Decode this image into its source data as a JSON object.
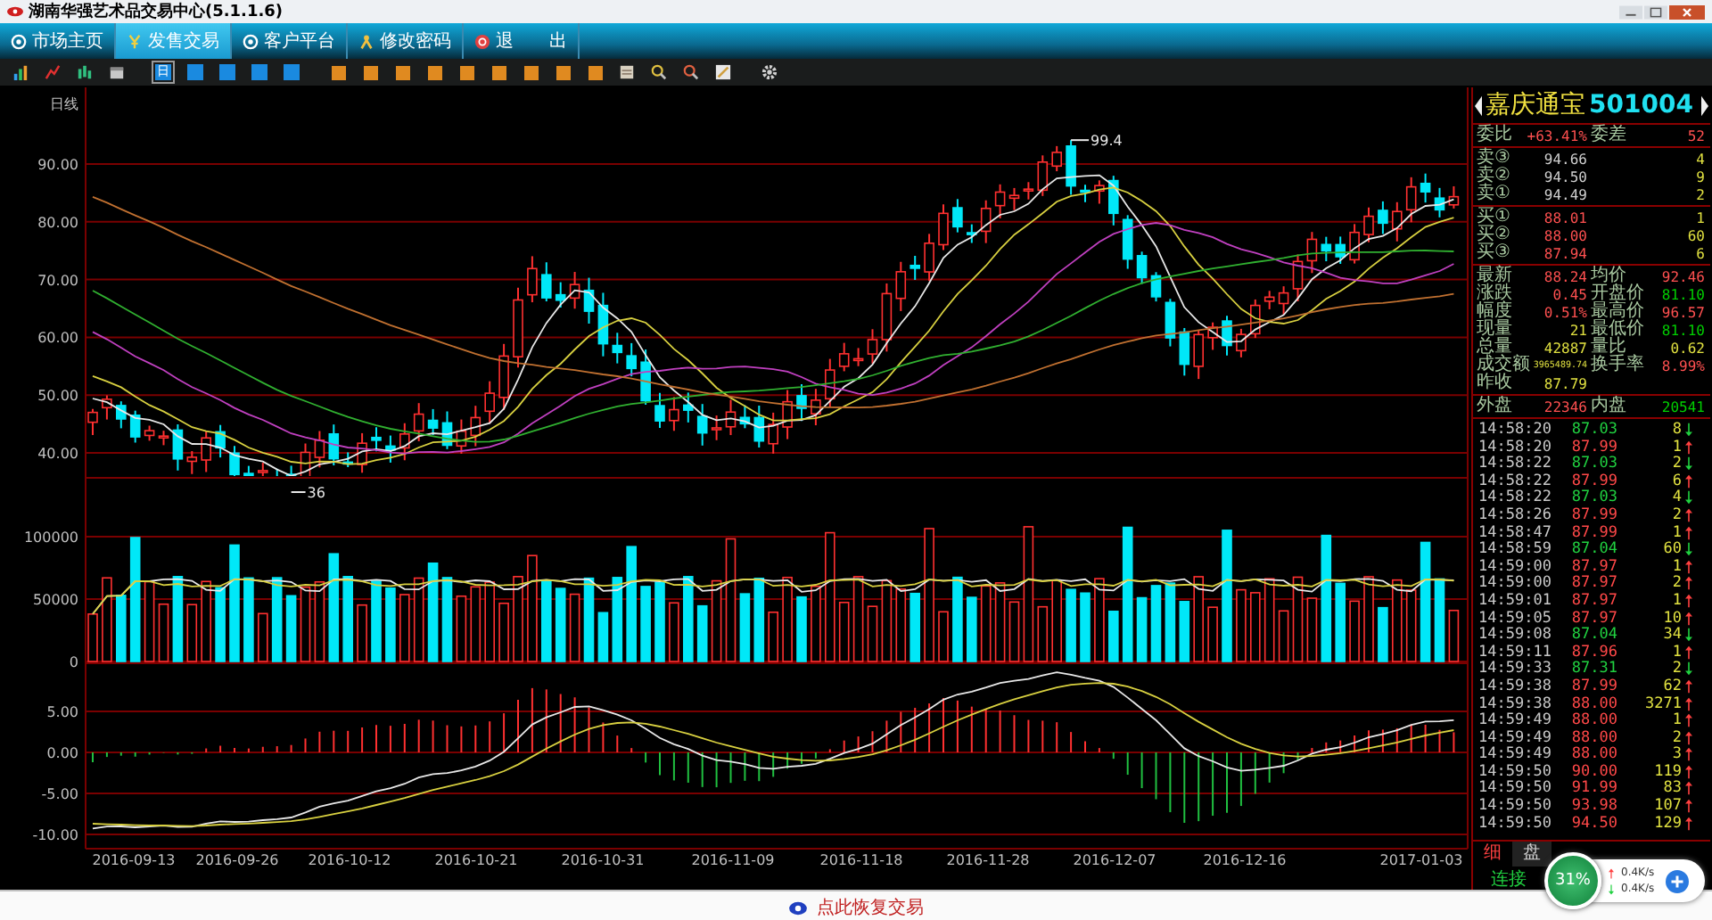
{
  "window": {
    "title": "湖南华强艺术品交易中心(5.1.1.6)"
  },
  "menu": [
    {
      "label": "市场主页",
      "selected": false
    },
    {
      "label": "发售交易",
      "selected": true
    },
    {
      "label": "客户平台",
      "selected": false
    },
    {
      "label": "修改密码",
      "selected": false
    },
    {
      "label": "退　　出",
      "selected": false
    }
  ],
  "toolbar": [
    {
      "kind": "bars",
      "selected": false
    },
    {
      "kind": "line",
      "selected": false
    },
    {
      "kind": "candles",
      "selected": false
    },
    {
      "kind": "window",
      "selected": false
    },
    {
      "kind": "blue",
      "label": "日",
      "selected": true
    },
    {
      "kind": "blue",
      "selected": false
    },
    {
      "kind": "blue",
      "selected": false
    },
    {
      "kind": "blue",
      "selected": false
    },
    {
      "kind": "blue",
      "selected": false
    },
    {
      "kind": "orange",
      "selected": false
    },
    {
      "kind": "orange",
      "selected": false
    },
    {
      "kind": "orange",
      "selected": false
    },
    {
      "kind": "orange",
      "selected": false
    },
    {
      "kind": "orange",
      "selected": false
    },
    {
      "kind": "orange",
      "selected": false
    },
    {
      "kind": "orange",
      "selected": false
    },
    {
      "kind": "orange",
      "selected": false
    },
    {
      "kind": "orange",
      "selected": false
    },
    {
      "kind": "doc",
      "selected": false
    },
    {
      "kind": "zoom-in",
      "selected": false
    },
    {
      "kind": "zoom-out",
      "selected": false
    },
    {
      "kind": "pen",
      "selected": false
    },
    {
      "kind": "gear",
      "selected": false
    }
  ],
  "chart": {
    "period_label": "日线",
    "high_label": "99.4",
    "low_label": "36",
    "price_ticks": [
      "90.00",
      "80.00",
      "70.00",
      "60.00",
      "50.00",
      "40.00"
    ],
    "volume_ticks": [
      "100000",
      "50000",
      "0"
    ],
    "macd_ticks": [
      "5.00",
      "0.00",
      "-5.00",
      "-10.00"
    ],
    "dates": [
      "2016-09-13",
      "2016-09-26",
      "2016-10-12",
      "2016-10-21",
      "2016-10-31",
      "2016-11-09",
      "2016-11-18",
      "2016-11-28",
      "2016-12-07",
      "2016-12-16",
      "2017-01-03"
    ]
  },
  "quote": {
    "name": "嘉庆通宝",
    "code": "501004",
    "sections": [
      [
        {
          "cells": [
            {
              "label": "委比",
              "value": "+63.41%",
              "color": "#ff5050"
            },
            {
              "label": "委差",
              "value": "52",
              "color": "#ff5050"
            }
          ]
        }
      ],
      [
        {
          "cells": [
            {
              "label": "卖③",
              "value": "94.66",
              "color": "#d0d0d0"
            },
            {
              "value": "4",
              "color": "#e0e040"
            }
          ]
        },
        {
          "cells": [
            {
              "label": "卖②",
              "value": "94.50",
              "color": "#d0d0d0"
            },
            {
              "value": "9",
              "color": "#e0e040"
            }
          ]
        },
        {
          "cells": [
            {
              "label": "卖①",
              "value": "94.49",
              "color": "#d0d0d0"
            },
            {
              "value": "2",
              "color": "#e0e040"
            }
          ]
        }
      ],
      [
        {
          "cells": [
            {
              "label": "买①",
              "value": "88.01",
              "color": "#ff5050"
            },
            {
              "value": "1",
              "color": "#e0e040"
            }
          ]
        },
        {
          "cells": [
            {
              "label": "买②",
              "value": "88.00",
              "color": "#ff5050"
            },
            {
              "value": "60",
              "color": "#e0e040"
            }
          ]
        },
        {
          "cells": [
            {
              "label": "买③",
              "value": "87.94",
              "color": "#ff5050"
            },
            {
              "value": "6",
              "color": "#e0e040"
            }
          ]
        }
      ],
      [
        {
          "cells": [
            {
              "label": "最新",
              "value": "88.24",
              "color": "#ff5050"
            },
            {
              "label": "均价",
              "value": "92.46",
              "color": "#ff5050"
            }
          ]
        },
        {
          "cells": [
            {
              "label": "涨跌",
              "value": "0.45",
              "color": "#ff5050"
            },
            {
              "label": "开盘价",
              "value": "81.10",
              "color": "#00d000"
            }
          ]
        },
        {
          "cells": [
            {
              "label": "幅度",
              "value": "0.51%",
              "color": "#ff5050"
            },
            {
              "label": "最高价",
              "value": "96.57",
              "color": "#ff5050"
            }
          ]
        },
        {
          "cells": [
            {
              "label": "现量",
              "value": "21",
              "color": "#e0e040"
            },
            {
              "label": "最低价",
              "value": "81.10",
              "color": "#00d000"
            }
          ]
        },
        {
          "cells": [
            {
              "label": "总量",
              "value": "42887",
              "color": "#e0e040"
            },
            {
              "label": "量比",
              "value": "0.62",
              "color": "#e0e040"
            }
          ]
        },
        {
          "cells": [
            {
              "label": "成交额",
              "value": "3965489.74",
              "color": "#e0e040",
              "compact": true
            },
            {
              "label": "换手率",
              "value": "8.99%",
              "color": "#ff5050"
            }
          ]
        },
        {
          "cells": [
            {
              "label": "昨收",
              "value": "87.79",
              "color": "#e0e040"
            }
          ]
        }
      ],
      [
        {
          "cells": [
            {
              "label": "外盘",
              "value": "22346",
              "color": "#ff5050"
            },
            {
              "label": "内盘",
              "value": "20541",
              "color": "#00d000"
            }
          ]
        }
      ]
    ]
  },
  "ticks": [
    {
      "time": "14:58:20",
      "price": "87.03",
      "volume": "8",
      "rising": false
    },
    {
      "time": "14:58:20",
      "price": "87.99",
      "volume": "1",
      "rising": true
    },
    {
      "time": "14:58:22",
      "price": "87.03",
      "volume": "2",
      "rising": false
    },
    {
      "time": "14:58:22",
      "price": "87.99",
      "volume": "6",
      "rising": true
    },
    {
      "time": "14:58:22",
      "price": "87.03",
      "volume": "4",
      "rising": false
    },
    {
      "time": "14:58:26",
      "price": "87.99",
      "volume": "2",
      "rising": true
    },
    {
      "time": "14:58:47",
      "price": "87.99",
      "volume": "1",
      "rising": true
    },
    {
      "time": "14:58:59",
      "price": "87.04",
      "volume": "60",
      "rising": false
    },
    {
      "time": "14:59:00",
      "price": "87.97",
      "volume": "1",
      "rising": true
    },
    {
      "time": "14:59:00",
      "price": "87.97",
      "volume": "2",
      "rising": true
    },
    {
      "time": "14:59:01",
      "price": "87.97",
      "volume": "1",
      "rising": true
    },
    {
      "time": "14:59:05",
      "price": "87.97",
      "volume": "10",
      "rising": true
    },
    {
      "time": "14:59:08",
      "price": "87.04",
      "volume": "34",
      "rising": false
    },
    {
      "time": "14:59:11",
      "price": "87.96",
      "volume": "1",
      "rising": true
    },
    {
      "time": "14:59:33",
      "price": "87.31",
      "volume": "2",
      "rising": false
    },
    {
      "time": "14:59:38",
      "price": "87.99",
      "volume": "62",
      "rising": true
    },
    {
      "time": "14:59:38",
      "price": "88.00",
      "volume": "3271",
      "rising": true
    },
    {
      "time": "14:59:49",
      "price": "88.00",
      "volume": "1",
      "rising": true
    },
    {
      "time": "14:59:49",
      "price": "88.00",
      "volume": "2",
      "rising": true
    },
    {
      "time": "14:59:49",
      "price": "88.00",
      "volume": "3",
      "rising": true
    },
    {
      "time": "14:59:50",
      "price": "90.00",
      "volume": "119",
      "rising": true
    },
    {
      "time": "14:59:50",
      "price": "91.99",
      "volume": "83",
      "rising": true
    },
    {
      "time": "14:59:50",
      "price": "93.98",
      "volume": "107",
      "rising": true
    },
    {
      "time": "14:59:50",
      "price": "94.50",
      "volume": "129",
      "rising": true
    }
  ],
  "panel_tabs": [
    {
      "label": "细",
      "selected": true
    },
    {
      "label": "盘",
      "selected": false
    }
  ],
  "status": {
    "connection": "连接"
  },
  "widget": {
    "percent": "31%",
    "upload": "0.4K/s",
    "download": "0.4K/s"
  },
  "footer": {
    "label": "点此恢复交易"
  }
}
